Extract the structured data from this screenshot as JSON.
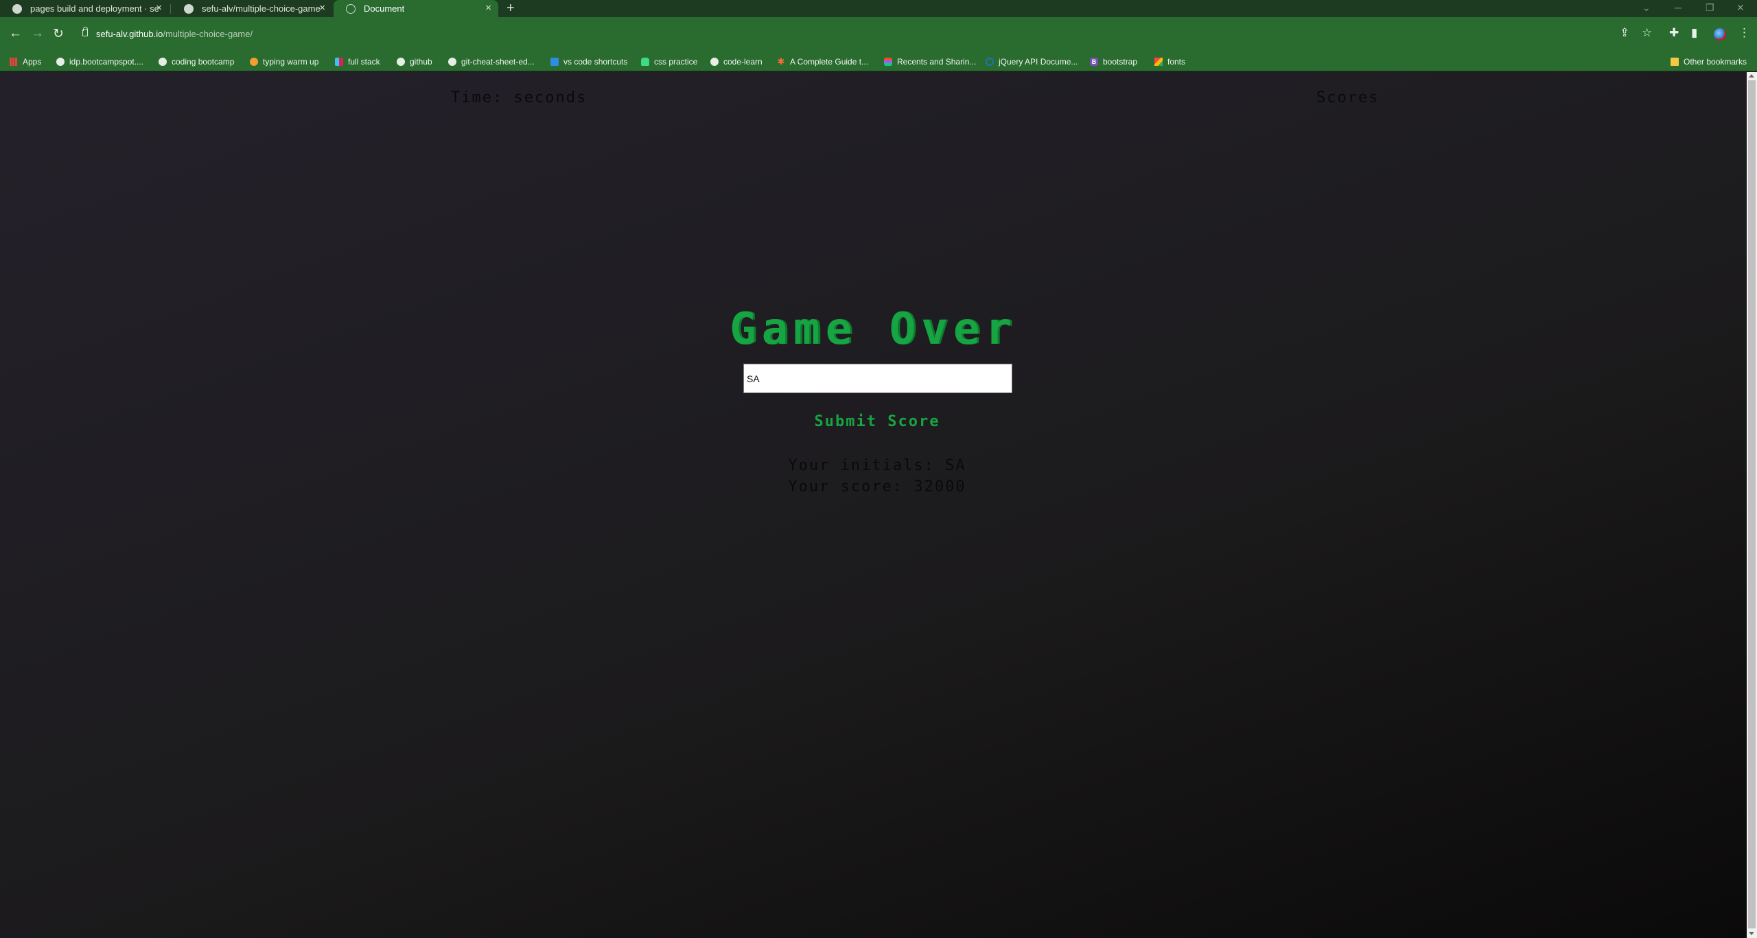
{
  "browser": {
    "tabs": [
      {
        "label": "pages build and deployment · se",
        "icon": "github-icon",
        "active": false
      },
      {
        "label": "sefu-alv/multiple-choice-game",
        "icon": "github-icon",
        "active": false
      },
      {
        "label": "Document",
        "icon": "globe-icon",
        "active": true
      }
    ],
    "new_tab_label": "+",
    "address": {
      "host": "sefu-alv.github.io",
      "path": "/multiple-choice-game/"
    },
    "bookmarks": [
      {
        "label": "Apps",
        "icon": "apps-grid-icon"
      },
      {
        "label": "idp.bootcampspot....",
        "icon": "globe-icon"
      },
      {
        "label": "coding bootcamp",
        "icon": "globe-icon"
      },
      {
        "label": "typing warm up",
        "icon": "mt-icon"
      },
      {
        "label": "full stack",
        "icon": "slack-icon"
      },
      {
        "label": "github",
        "icon": "github-icon"
      },
      {
        "label": "git-cheat-sheet-ed...",
        "icon": "github-icon"
      },
      {
        "label": "vs code shortcuts",
        "icon": "vscode-icon"
      },
      {
        "label": "css practice",
        "icon": "android-icon"
      },
      {
        "label": "code-learn",
        "icon": "globe-icon"
      },
      {
        "label": "A Complete Guide t...",
        "icon": "star-icon"
      },
      {
        "label": "Recents and Sharin...",
        "icon": "figma-icon"
      },
      {
        "label": "jQuery API Docume...",
        "icon": "jquery-icon"
      },
      {
        "label": "bootstrap",
        "icon": "bootstrap-icon"
      },
      {
        "label": "fonts",
        "icon": "fonts-icon"
      }
    ],
    "other_bookmarks": "Other bookmarks",
    "colors": {
      "tabstrip": "#1d3b20",
      "toolbar": "#2a6b30"
    }
  },
  "page": {
    "timer": "Time: seconds",
    "scores_link": "Scores",
    "title": "Game Over",
    "initials_value": "SA",
    "submit_label": "Submit Score",
    "result_initials": "Your initials: SA",
    "result_score": "Your score: 32000",
    "colors": {
      "accent": "#17a442",
      "text": "#0a0a0a"
    }
  }
}
